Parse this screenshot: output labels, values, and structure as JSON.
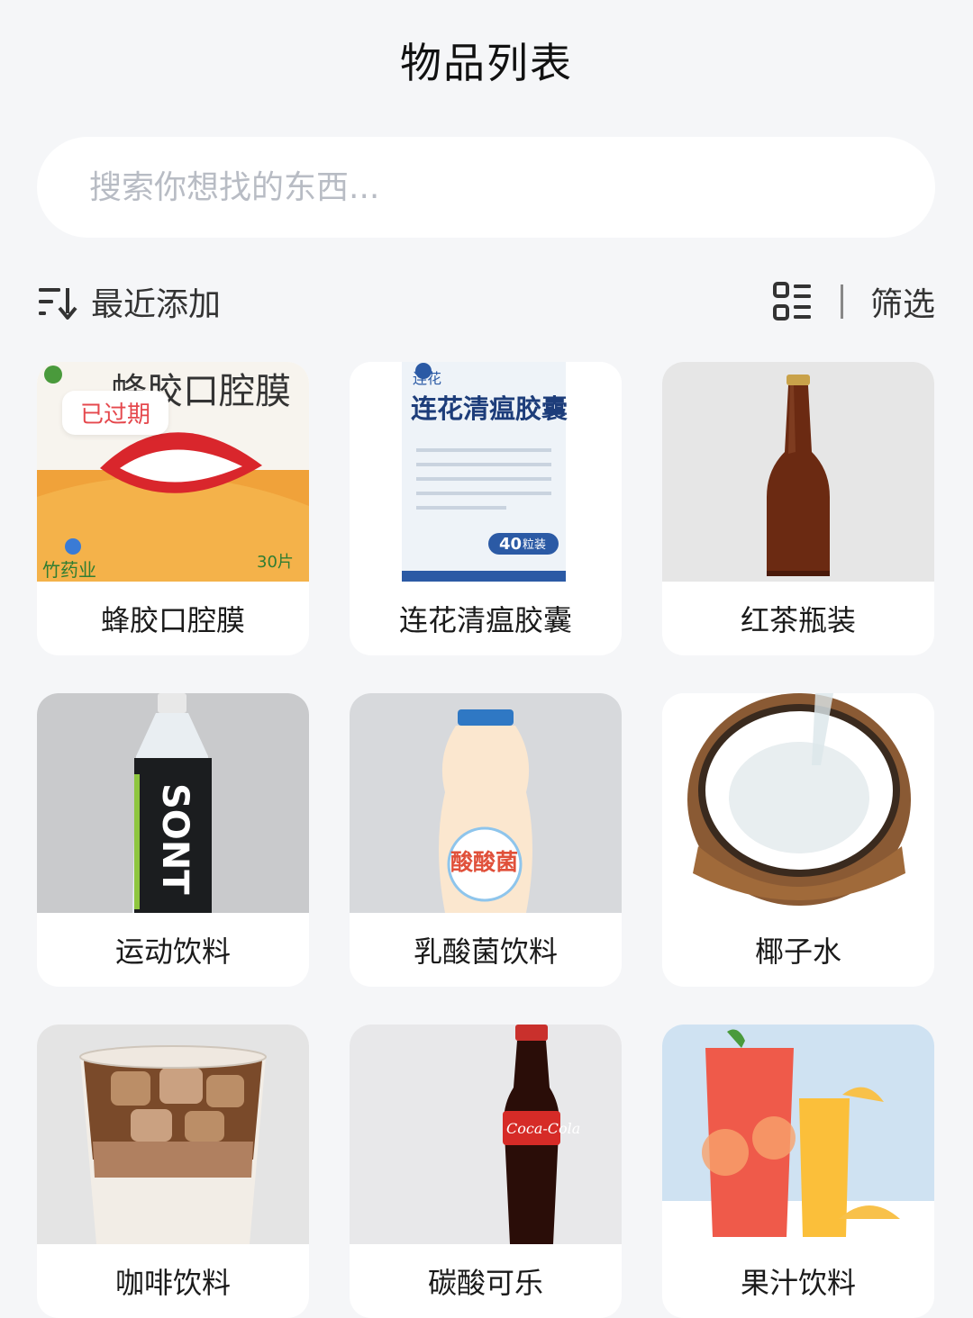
{
  "header": {
    "title": "物品列表"
  },
  "search": {
    "placeholder": "搜索你想找的东西..."
  },
  "toolbar": {
    "sort_label": "最近添加",
    "filter_label": "筛选",
    "sort_icon": "sort-descending-icon",
    "view_icon": "list-view-icon"
  },
  "items": [
    {
      "name": "蜂胶口腔膜",
      "badge": "已过期",
      "img_texts": [
        "蜂胶口腔膜",
        "30片",
        "竹药业"
      ]
    },
    {
      "name": "连花清瘟胶囊",
      "img_texts": [
        "连花",
        "连花清瘟胶囊",
        "40",
        "粒装"
      ]
    },
    {
      "name": "红茶瓶装"
    },
    {
      "name": "运动饮料",
      "img_texts": [
        "SONT"
      ]
    },
    {
      "name": "乳酸菌饮料",
      "img_texts": [
        "酸酸菌"
      ]
    },
    {
      "name": "椰子水"
    },
    {
      "name": "咖啡饮料"
    },
    {
      "name": "碳酸可乐",
      "img_texts": [
        "Coca-Cola"
      ]
    },
    {
      "name": "果汁饮料"
    }
  ],
  "colors": {
    "background": "#f5f6f8",
    "card": "#ffffff",
    "badge_text": "#e5484d",
    "placeholder": "#b8bcc4"
  }
}
